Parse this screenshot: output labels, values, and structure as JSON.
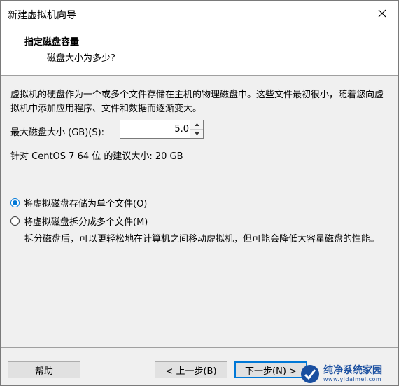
{
  "window": {
    "title": "新建虚拟机向导",
    "close_icon": "close-icon"
  },
  "header": {
    "title": "指定磁盘容量",
    "subtitle": "磁盘大小为多少?"
  },
  "content": {
    "description": "虚拟机的硬盘作为一个或多个文件存储在主机的物理磁盘中。这些文件最初很小，随着您向虚拟机中添加应用程序、文件和数据而逐渐变大。",
    "max_size_label": "最大磁盘大小 (GB)(S):",
    "max_size_value": "5.0",
    "recommended_text": "针对 CentOS 7 64 位 的建议大小: 20 GB",
    "radio_single": {
      "label": "将虚拟磁盘存储为单个文件(O)",
      "checked": true
    },
    "radio_split": {
      "label": "将虚拟磁盘拆分成多个文件(M)",
      "checked": false
    },
    "split_description": "拆分磁盘后，可以更轻松地在计算机之间移动虚拟机，但可能会降低大容量磁盘的性能。"
  },
  "footer": {
    "help_label": "帮助",
    "back_label": "< 上一步(B)",
    "next_label": "下一步(N) >"
  },
  "watermark": {
    "title": "纯净系统家园",
    "url": "www.yidaimei.com",
    "icon": "logo-icon"
  },
  "colors": {
    "accent": "#0078d7",
    "panel_bg": "#f0f0f0",
    "watermark": "#1a4fa0"
  }
}
